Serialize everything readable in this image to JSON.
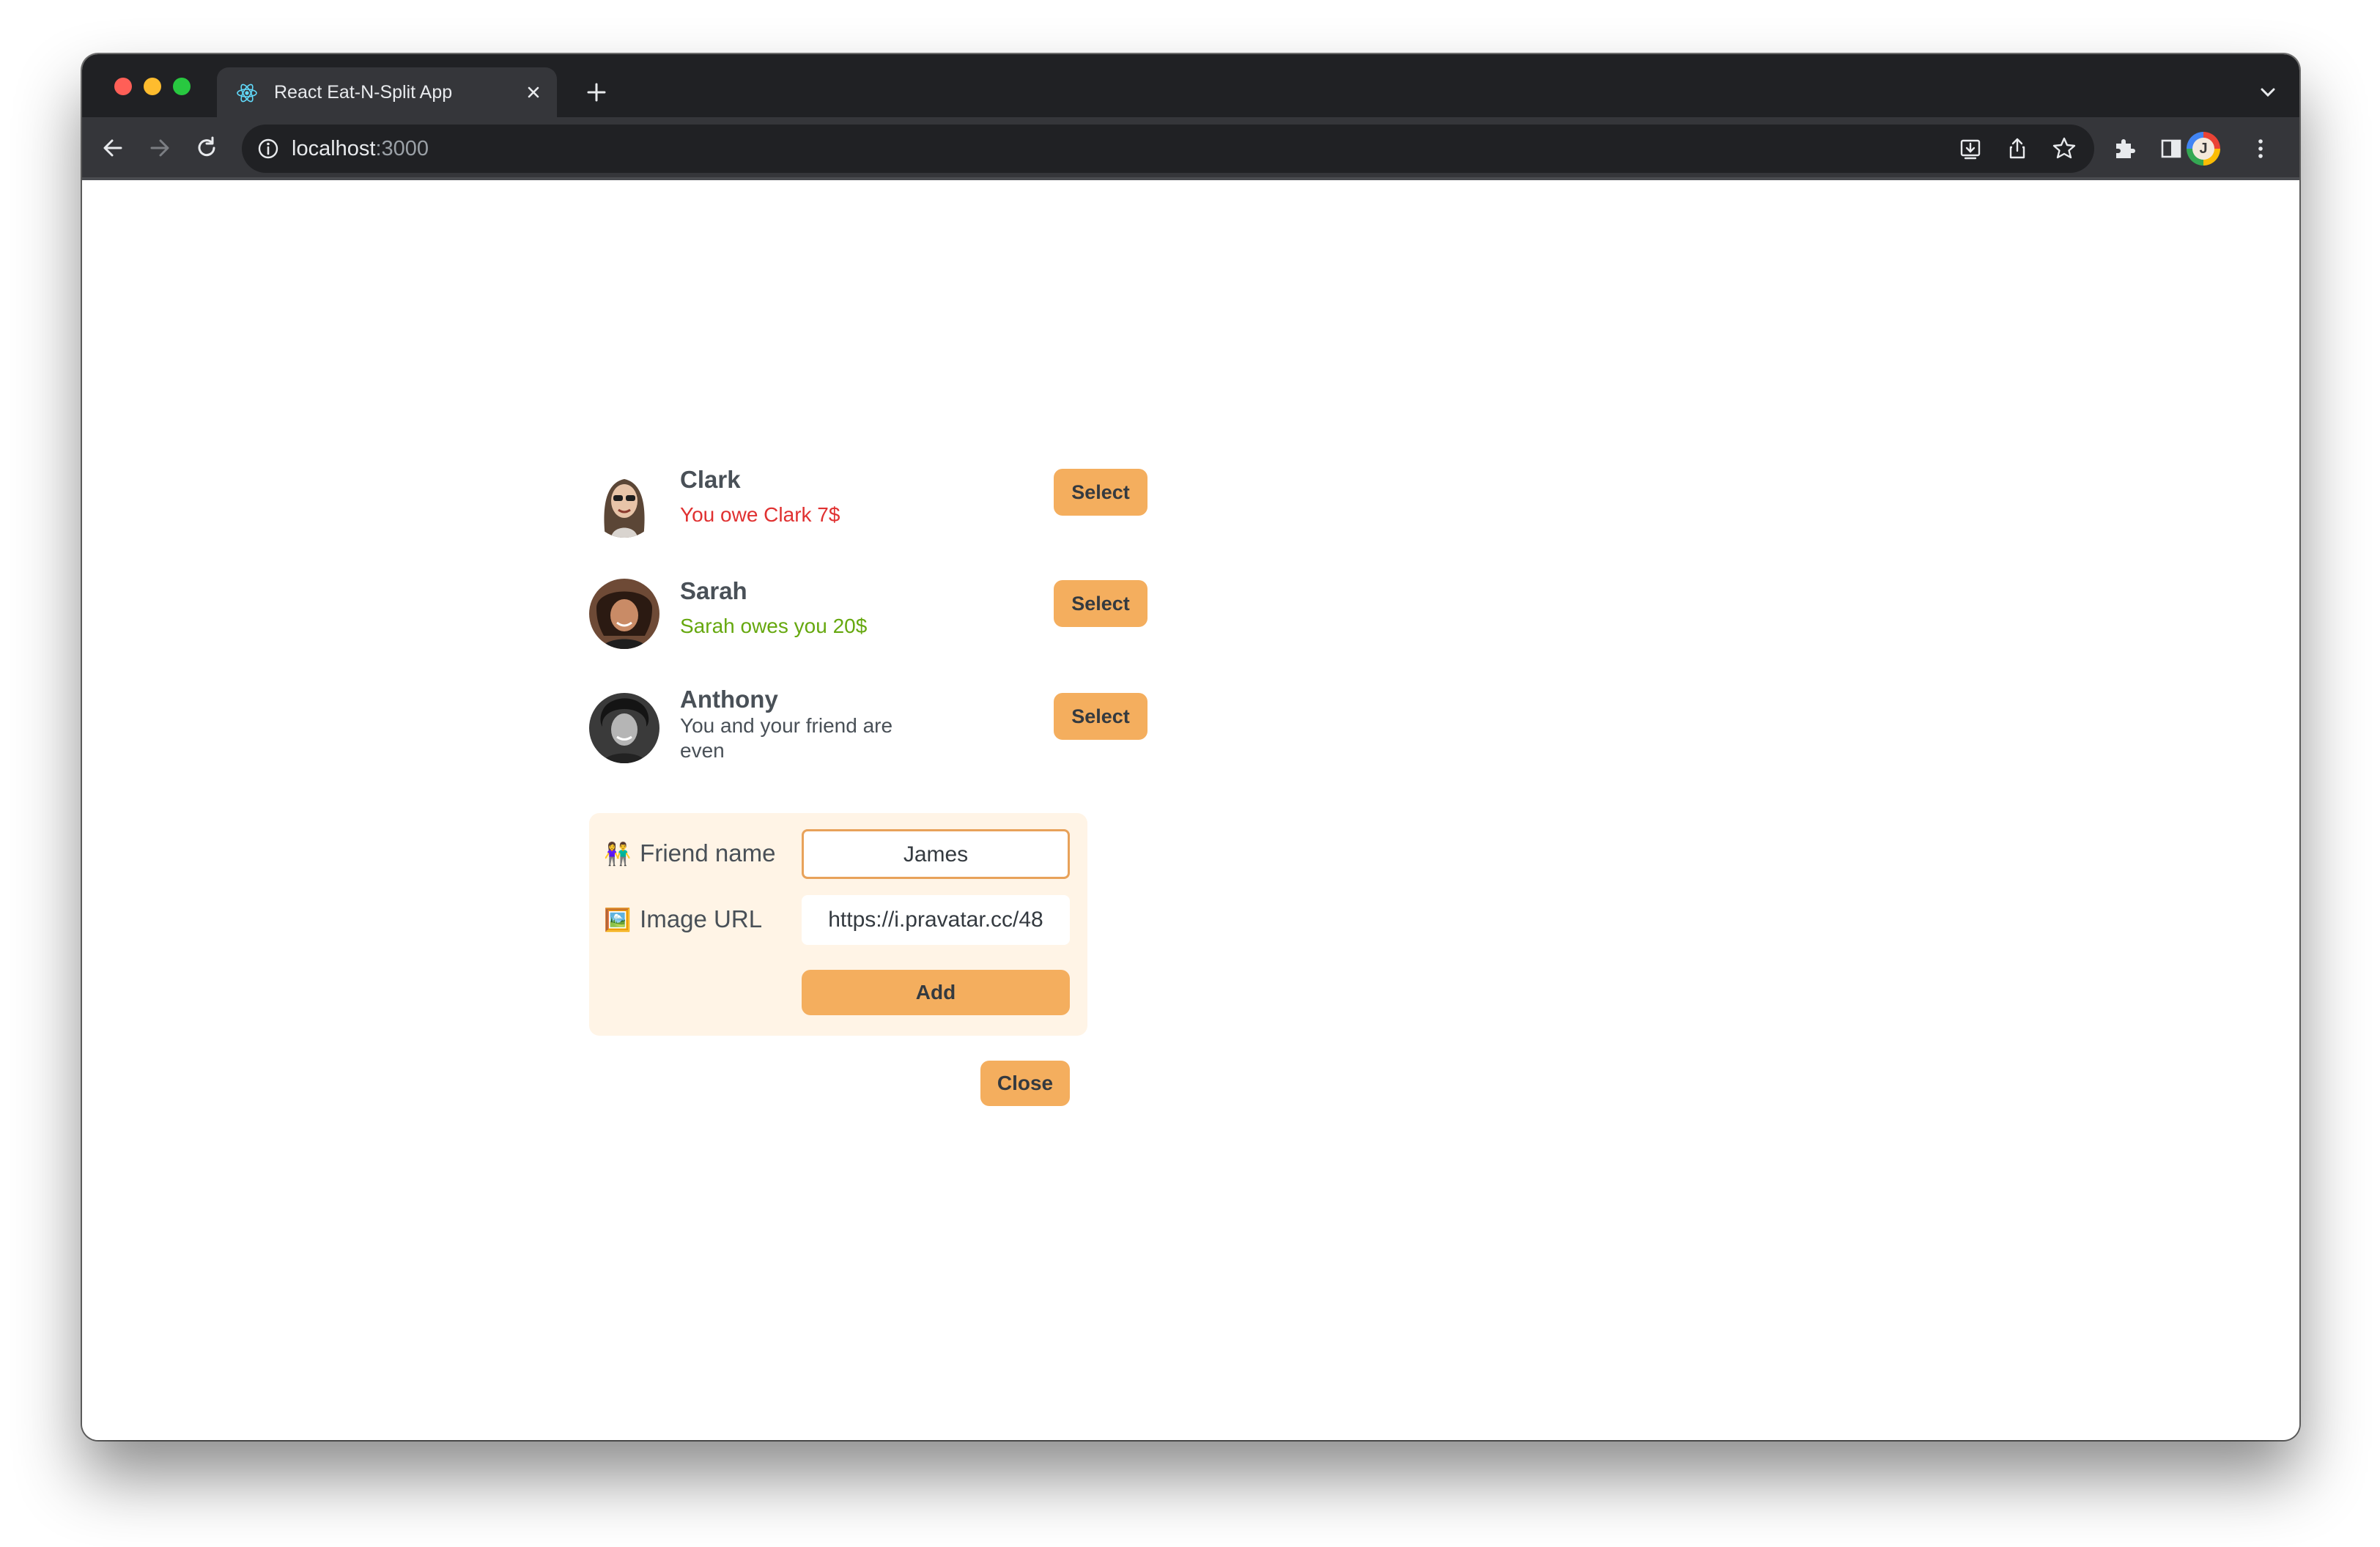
{
  "browser": {
    "tab_title": "React Eat-N-Split App",
    "url_host": "localhost",
    "url_port": ":3000"
  },
  "friends": [
    {
      "name": "Clark",
      "status": "You owe Clark 7$",
      "status_color": "#e03131",
      "button": "Select"
    },
    {
      "name": "Sarah",
      "status": "Sarah owes you 20$",
      "status_color": "#66a80f",
      "button": "Select"
    },
    {
      "name": "Anthony",
      "status": "You and your friend are even",
      "status_color": "#495057",
      "button": "Select"
    }
  ],
  "add_form": {
    "name_label": "Friend name",
    "name_emoji": "👫",
    "name_value": "James",
    "image_label": "Image URL",
    "image_emoji": "🖼️",
    "image_value": "https://i.pravatar.cc/48",
    "submit_label": "Add"
  },
  "close_button": "Close",
  "colors": {
    "accent": "#f4ae5e",
    "form_bg": "#fff4e6",
    "owe_red": "#e03131",
    "owed_green": "#66a80f"
  }
}
